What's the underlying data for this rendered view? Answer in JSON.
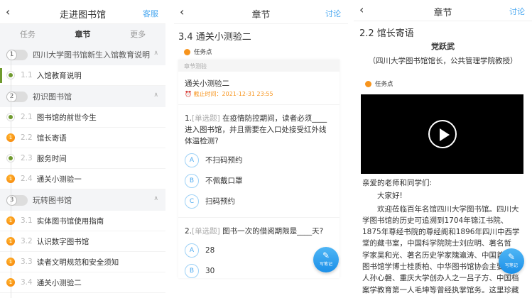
{
  "panel1": {
    "title": "走进图书馆",
    "action": "客服",
    "tabs": [
      "任务",
      "章节",
      "更多"
    ],
    "sections": [
      {
        "num": "1",
        "label": "四川大学图书馆新生入馆教育说明",
        "items": [
          {
            "num": "1.1",
            "label": "入馆教育说明",
            "status": "done"
          }
        ]
      },
      {
        "num": "2",
        "label": "初识图书馆",
        "items": [
          {
            "num": "2.1",
            "label": "图书馆的前世今生",
            "status": "done"
          },
          {
            "num": "2.2",
            "label": "馆长寄语",
            "status": "pending"
          },
          {
            "num": "2.3",
            "label": "服务时间",
            "status": "done"
          },
          {
            "num": "2.4",
            "label": "通关小测验一",
            "status": "pending"
          }
        ]
      },
      {
        "num": "3",
        "label": "玩转图书馆",
        "items": [
          {
            "num": "3.1",
            "label": "实体图书馆使用指南",
            "status": "pending"
          },
          {
            "num": "3.2",
            "label": "认识数字图书馆",
            "status": "pending"
          },
          {
            "num": "3.3",
            "label": "读者文明规范和安全须知",
            "status": "pending"
          },
          {
            "num": "3.4",
            "label": "通关小测验二",
            "status": "pending"
          }
        ]
      }
    ],
    "badge": "1"
  },
  "panel2": {
    "title": "章节",
    "action": "讨论",
    "heading": "3.4 通关小测验二",
    "task_label": "任务点",
    "card_header": "章节测验",
    "quiz_title": "通关小测验二",
    "deadline": "截止时间：2021-12-31 23:55",
    "q1": {
      "num": "1.",
      "type": "[单选题]",
      "text": "在疫情防控期间，读者必须____进入图书馆，并且需要在入口处接受红外线体温检测?",
      "options": [
        {
          "key": "A",
          "text": "不扫码预约"
        },
        {
          "key": "B",
          "text": "不佩戴口罩"
        },
        {
          "key": "C",
          "text": "扫码预约"
        }
      ]
    },
    "q2": {
      "num": "2.",
      "type": "[单选题]",
      "text": "图书一次的借阅期限是____天?",
      "options": [
        {
          "key": "A",
          "text": "28"
        },
        {
          "key": "B",
          "text": "30"
        }
      ]
    },
    "fab": "写笔记"
  },
  "panel3": {
    "title": "章节",
    "action": "讨论",
    "heading": "2.2 馆长寄语",
    "name": "党跃武",
    "role": "（四川大学图书馆馆长，公共管理学院教授）",
    "task_label": "任务点",
    "fab": "写笔记",
    "lines": [
      "亲爱的老师和同学们:",
      "　　大家好!",
      "　　欢迎莅临百年名馆四川大学图书馆。四川大",
      "学图书馆的历史可追溯到1704年锦江书院、",
      "1875年尊经书院的尊经阁和1896年四川中西学",
      "堂的藏书室，中国科学院院士刘应明、著名哲",
      "学家吴和光、著名历史学家隗瀛涛、中国首位",
      "图书馆学博士桂质柏、中华图书馆协会主要发起",
      "人孙心磐、重庆大学创办人之一吕子方、中国档",
      "案学教育第一人毛坤等曾经执掌馆务。这里珍藏"
    ]
  }
}
